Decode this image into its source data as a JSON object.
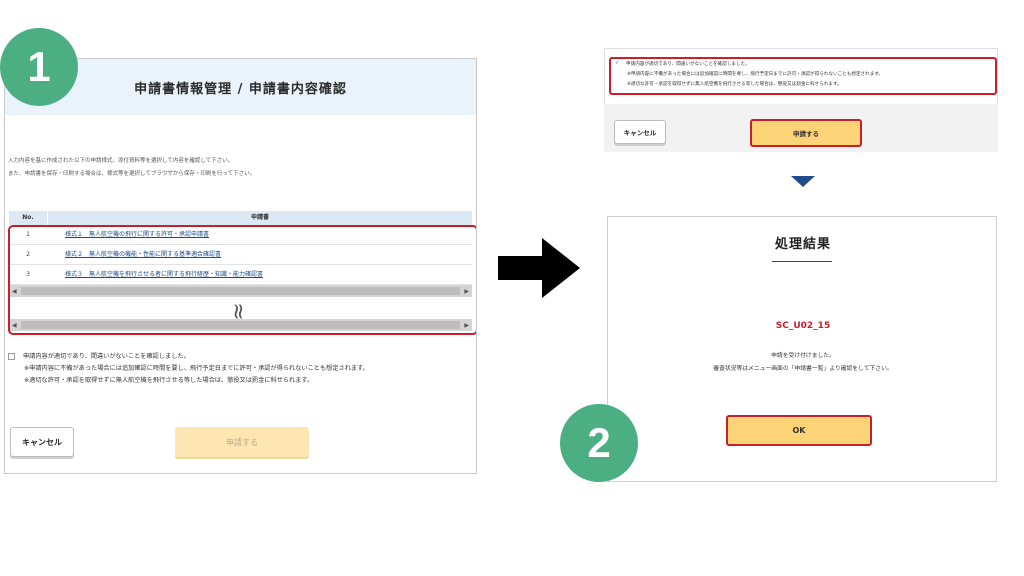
{
  "step1": {
    "badge": "1",
    "header_title": "申請書情報管理 / 申請書内容確認",
    "intro_line1": "入力内容を基に作成された以下の申請様式、添付資料等を選択して内容を確認して下さい。",
    "intro_line2": "また、申請書を保存・印刷する場合は、様式等を選択してブラウザから保存・印刷を行って下さい。",
    "table": {
      "col_no": "No.",
      "col_doc": "申請書",
      "rows": [
        {
          "no": "1",
          "doc": "様式１　無人航空機の飛行に関する許可・承認申請書"
        },
        {
          "no": "2",
          "doc": "様式２　無人航空機の機能・性能に関する基準適合確認書"
        },
        {
          "no": "3",
          "doc": "様式３　無人航空機を飛行させる者に関する飛行経歴・知識・能力確認書"
        }
      ]
    },
    "confirm_main": "申請内容が適切であり、間違いがないことを確認しました。",
    "confirm_note1": "※申請内容に不備があった場合には追加確認に時間を要し、飛行予定日までに許可・承認が得られないことも想定されます。",
    "confirm_note2": "※適切な許可・承認を取得せずに無人航空機を飛行させる等した場合は、懲役又は罰金に科せられます。",
    "cancel_label": "キャンセル",
    "apply_label": "申請する"
  },
  "step2": {
    "badge": "2",
    "confirm_main": "申請内容が適切であり、間違いがないことを確認しました。",
    "confirm_note1": "※申請内容に不備があった場合には追加確認に時間を要し、飛行予定日までに許可・承認が得られないことも想定されます。",
    "confirm_note2": "※適切な許可・承認を取得せずに無人航空機を飛行させる等した場合は、懲役又は罰金に科せられます。",
    "cancel_label": "キャンセル",
    "apply_label": "申請する",
    "result_title": "処理結果",
    "result_code": "SC_U02_15",
    "result_msg1": "申請を受け付けました。",
    "result_msg2": "審査状況等はメニュー画面の「申請書一覧」より確認をして下さい。",
    "ok_label": "OK"
  },
  "colors": {
    "highlight_red": "#c8202b",
    "badge_green": "#4caf84",
    "button_yellow": "#fdd377",
    "header_blue": "#eaf3fb",
    "accent_navy": "#1f4b8a"
  },
  "icons": {
    "arrow": "right-arrow-icon",
    "down": "down-triangle-icon",
    "break": "squiggle-break-icon"
  }
}
